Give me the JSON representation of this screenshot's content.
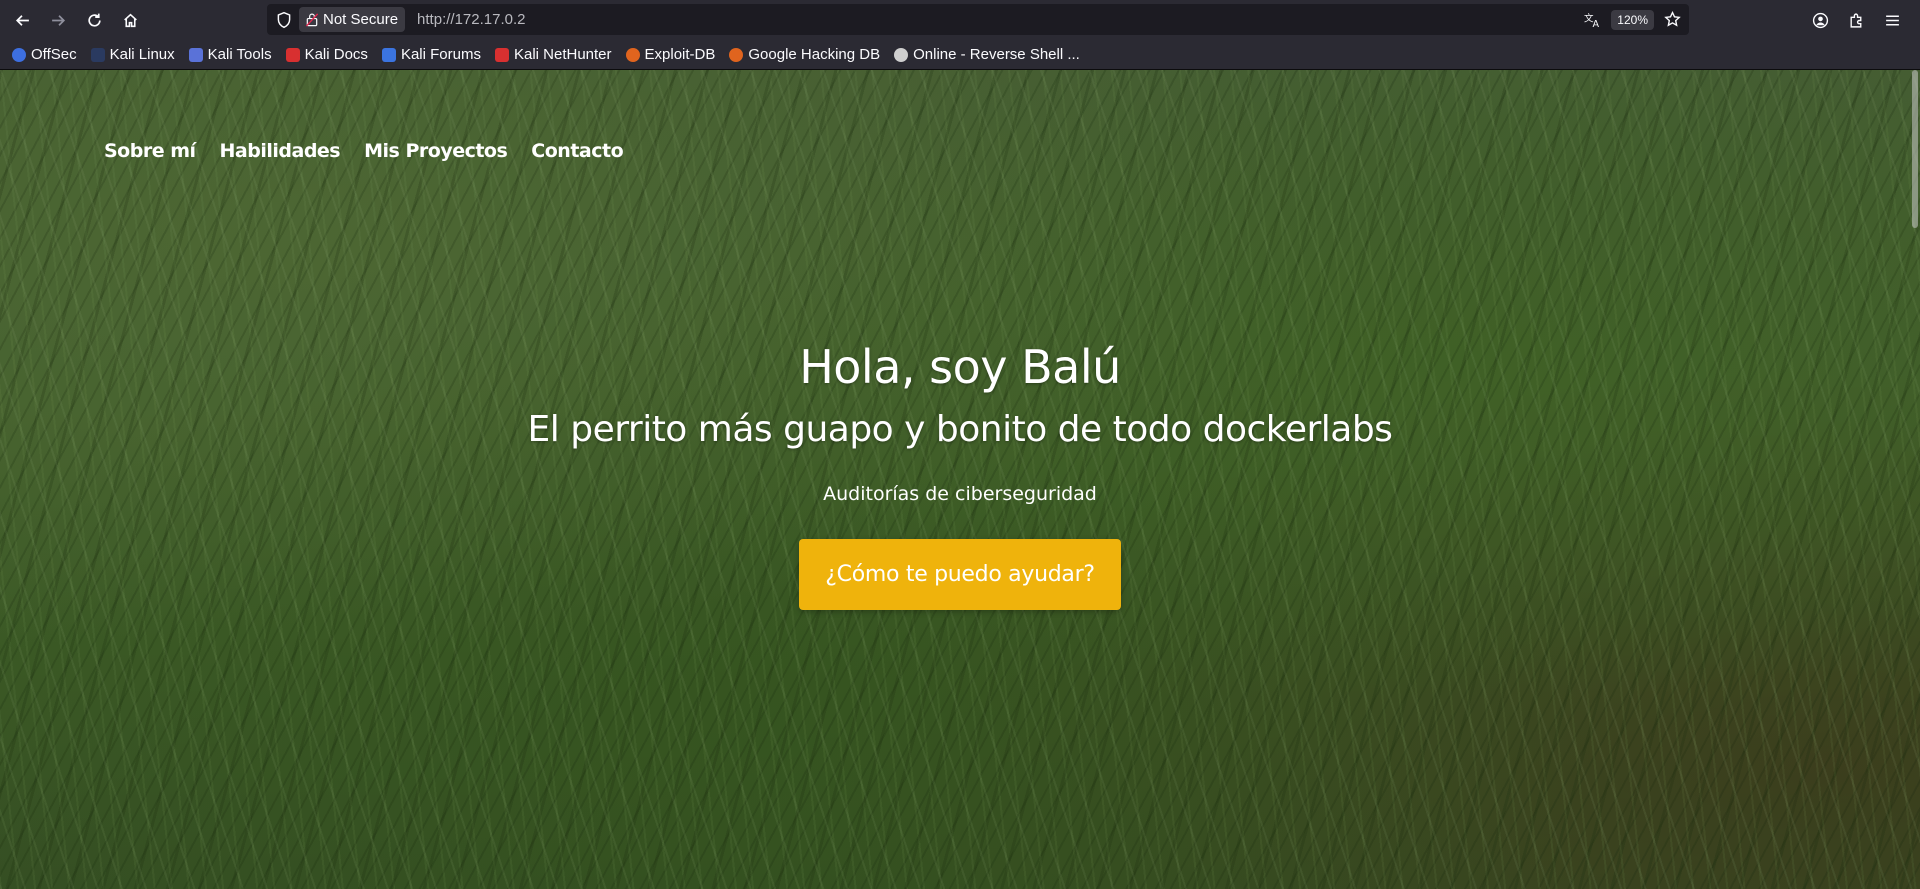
{
  "browser": {
    "security_label": "Not Secure",
    "url": "http://172.17.0.2",
    "zoom": "120%"
  },
  "bookmarks": [
    {
      "label": "OffSec",
      "color": "#3d6fe0"
    },
    {
      "label": "Kali Linux",
      "color": "#2a3a60"
    },
    {
      "label": "Kali Tools",
      "color": "#5a72d8"
    },
    {
      "label": "Kali Docs",
      "color": "#d83030"
    },
    {
      "label": "Kali Forums",
      "color": "#3b74e0"
    },
    {
      "label": "Kali NetHunter",
      "color": "#d83030"
    },
    {
      "label": "Exploit-DB",
      "color": "#e0641e"
    },
    {
      "label": "Google Hacking DB",
      "color": "#e0641e"
    },
    {
      "label": "Online - Reverse Shell ...",
      "color": "#cfcfcf"
    }
  ],
  "site": {
    "nav": [
      "Sobre mí",
      "Habilidades",
      "Mis Proyectos",
      "Contacto"
    ],
    "title": "Hola, soy Balú",
    "subtitle": "El perrito más guapo y bonito de todo dockerlabs",
    "tagline": "Auditorías de ciberseguridad",
    "cta": "¿Cómo te puedo ayudar?"
  },
  "colors": {
    "cta_background": "#efb30c",
    "chrome_background": "#2b2a33"
  }
}
